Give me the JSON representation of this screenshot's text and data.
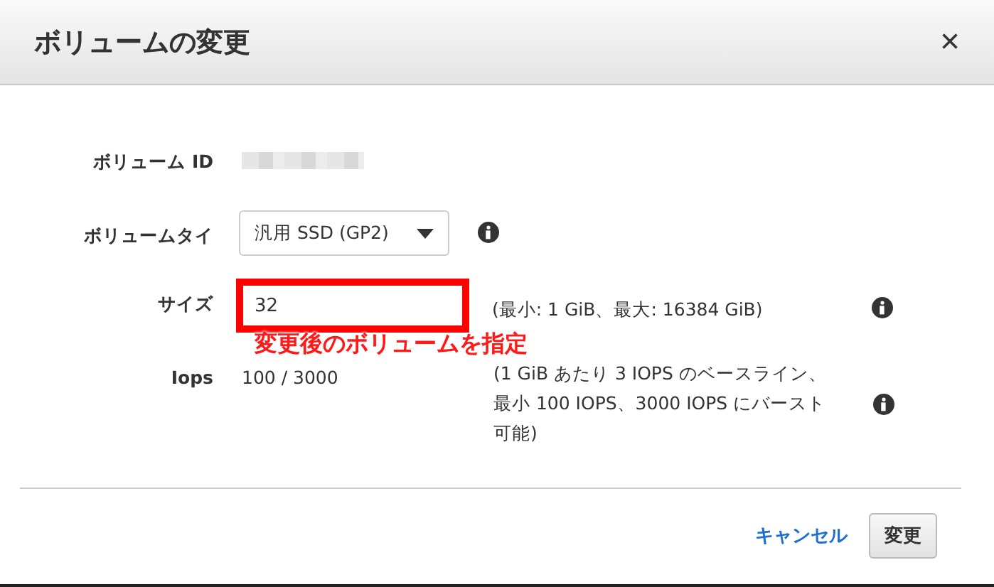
{
  "dialog": {
    "title": "ボリュームの変更",
    "close": "×"
  },
  "fields": [
    {
      "kind": "redacted",
      "label": "ボリューム ID"
    },
    {
      "kind": "select",
      "label": "ボリュームタイ",
      "value": "汎用 SSD (GP2)"
    },
    {
      "kind": "input",
      "label": "サイズ",
      "value": "32",
      "hint": "(最小: 1 GiB、最大: 16384 GiB)",
      "highlighted": true,
      "annotation": "変更後のボリュームを指定"
    },
    {
      "kind": "text",
      "label": "Iops",
      "value": "100 / 3000",
      "hint": "(1 GiB あたり 3 IOPS のベースライン、最小 100 IOPS、3000 IOPS にバースト可能)"
    }
  ],
  "buttons": {
    "cancel": "キャンセル",
    "submit": "変更"
  }
}
